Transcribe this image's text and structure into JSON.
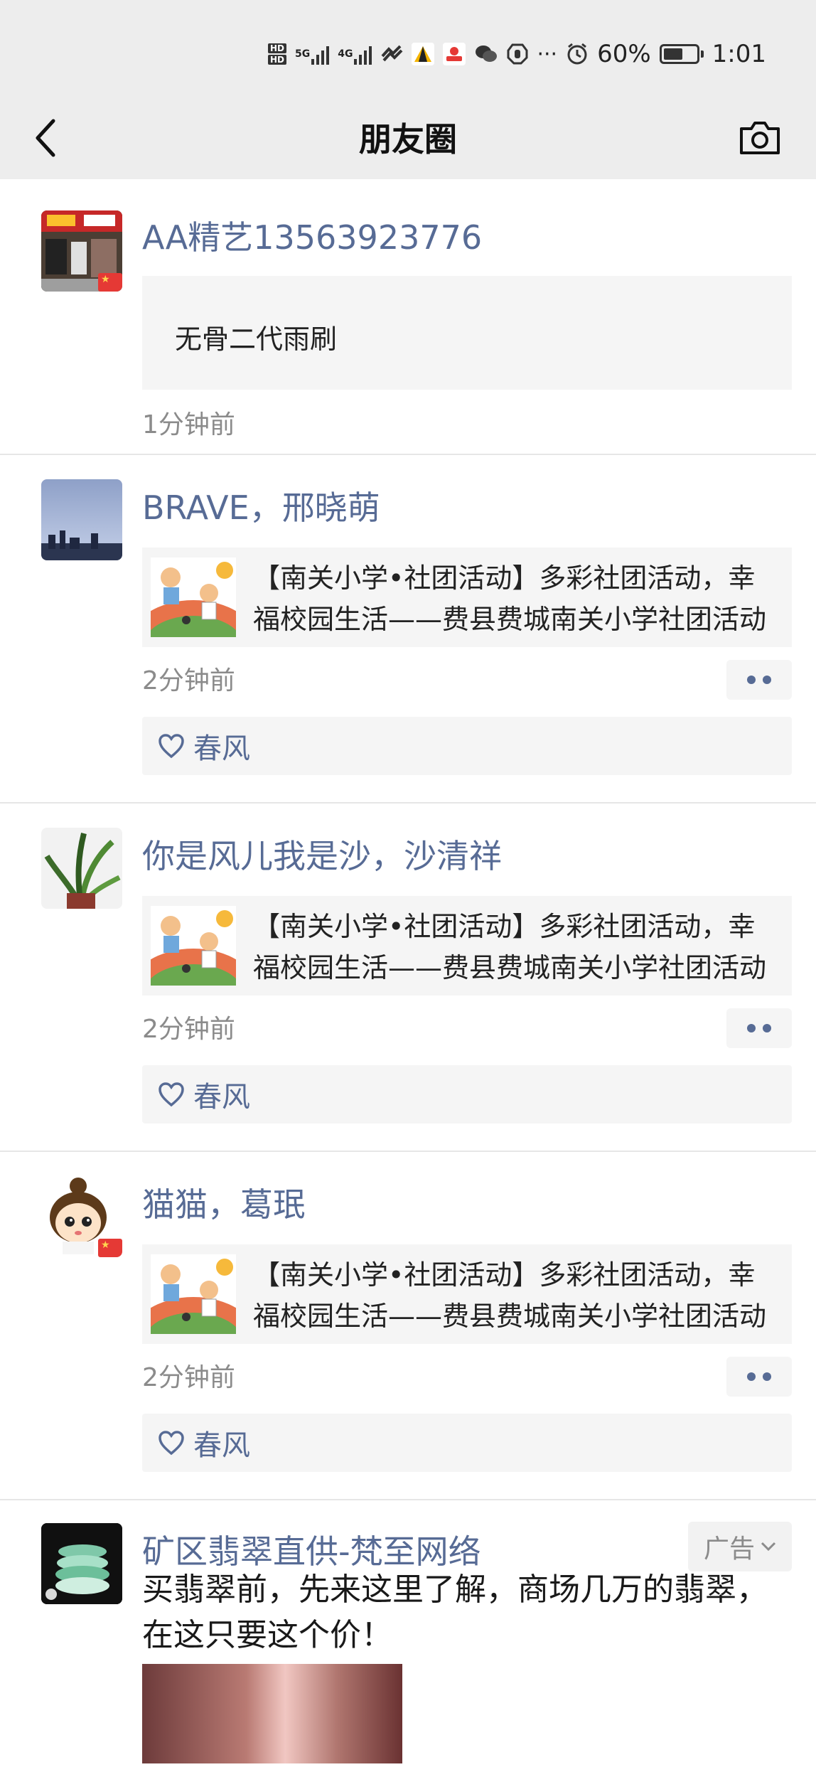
{
  "status_bar": {
    "hd1": "HD",
    "hd2": "HD",
    "net5g": "5G",
    "net4g": "4G",
    "battery": "60%",
    "time": "1:01",
    "dots": "···"
  },
  "header": {
    "title": "朋友圈"
  },
  "posts": [
    {
      "name": "AA精艺13563923776",
      "text": "无骨二代雨刷",
      "time": "1分钟前"
    },
    {
      "name": "BRAVE，邢晓萌",
      "link_line1": "【南关小学•社团活动】多彩社团活动，幸",
      "link_line2": "福校园生活——费县费城南关小学社团活动",
      "time": "2分钟前",
      "like": "春风"
    },
    {
      "name": "你是风儿我是沙，沙清祥",
      "link_line1": "【南关小学•社团活动】多彩社团活动，幸",
      "link_line2": "福校园生活——费县费城南关小学社团活动",
      "time": "2分钟前",
      "like": "春风"
    },
    {
      "name": "猫猫，葛珉",
      "link_line1": "【南关小学•社团活动】多彩社团活动，幸",
      "link_line2": "福校园生活——费县费城南关小学社团活动",
      "time": "2分钟前",
      "like": "春风"
    }
  ],
  "ad": {
    "name": "矿区翡翠直供-梵至网络",
    "tag": "广告",
    "text": "买翡翠前，先来这里了解，商场几万的翡翠，在这只要这个价！"
  }
}
